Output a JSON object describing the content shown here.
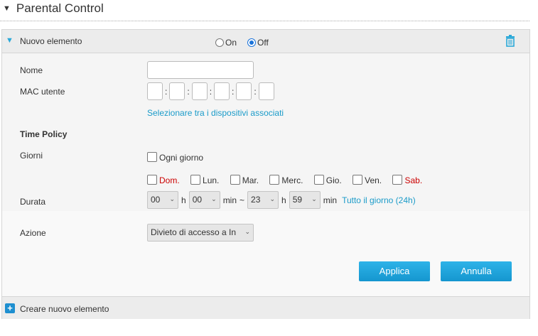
{
  "page": {
    "title": "Parental Control"
  },
  "rule": {
    "name": "Nuovo elemento",
    "on_label": "On",
    "off_label": "Off",
    "selected": "Off"
  },
  "form": {
    "name_label": "Nome",
    "name_value": "",
    "mac_label": "MAC utente",
    "mac_values": [
      "",
      "",
      "",
      "",
      "",
      ""
    ],
    "mac_sep": ":",
    "select_devices_link": "Selezionare tra i dispositivi associati",
    "time_policy_label": "Time Policy",
    "days_label": "Giorni",
    "every_day_label": "Ogni giorno",
    "days": [
      "Dom.",
      "Lun.",
      "Mar.",
      "Merc.",
      "Gio.",
      "Ven.",
      "Sab."
    ],
    "duration_label": "Durata",
    "start_hour": "00",
    "start_min": "00",
    "end_hour": "23",
    "end_min": "59",
    "h_unit": "h",
    "min_unit": "min",
    "tilde": "~",
    "all_day_link": "Tutto il giorno (24h)",
    "action_label": "Azione",
    "action_value": "Divieto di accesso a In"
  },
  "buttons": {
    "apply": "Applica",
    "cancel": "Annulla"
  },
  "footer": {
    "create_label": "Creare nuovo elemento"
  },
  "colors": {
    "accent": "#1a9bc9",
    "weekend": "#cc0000"
  }
}
